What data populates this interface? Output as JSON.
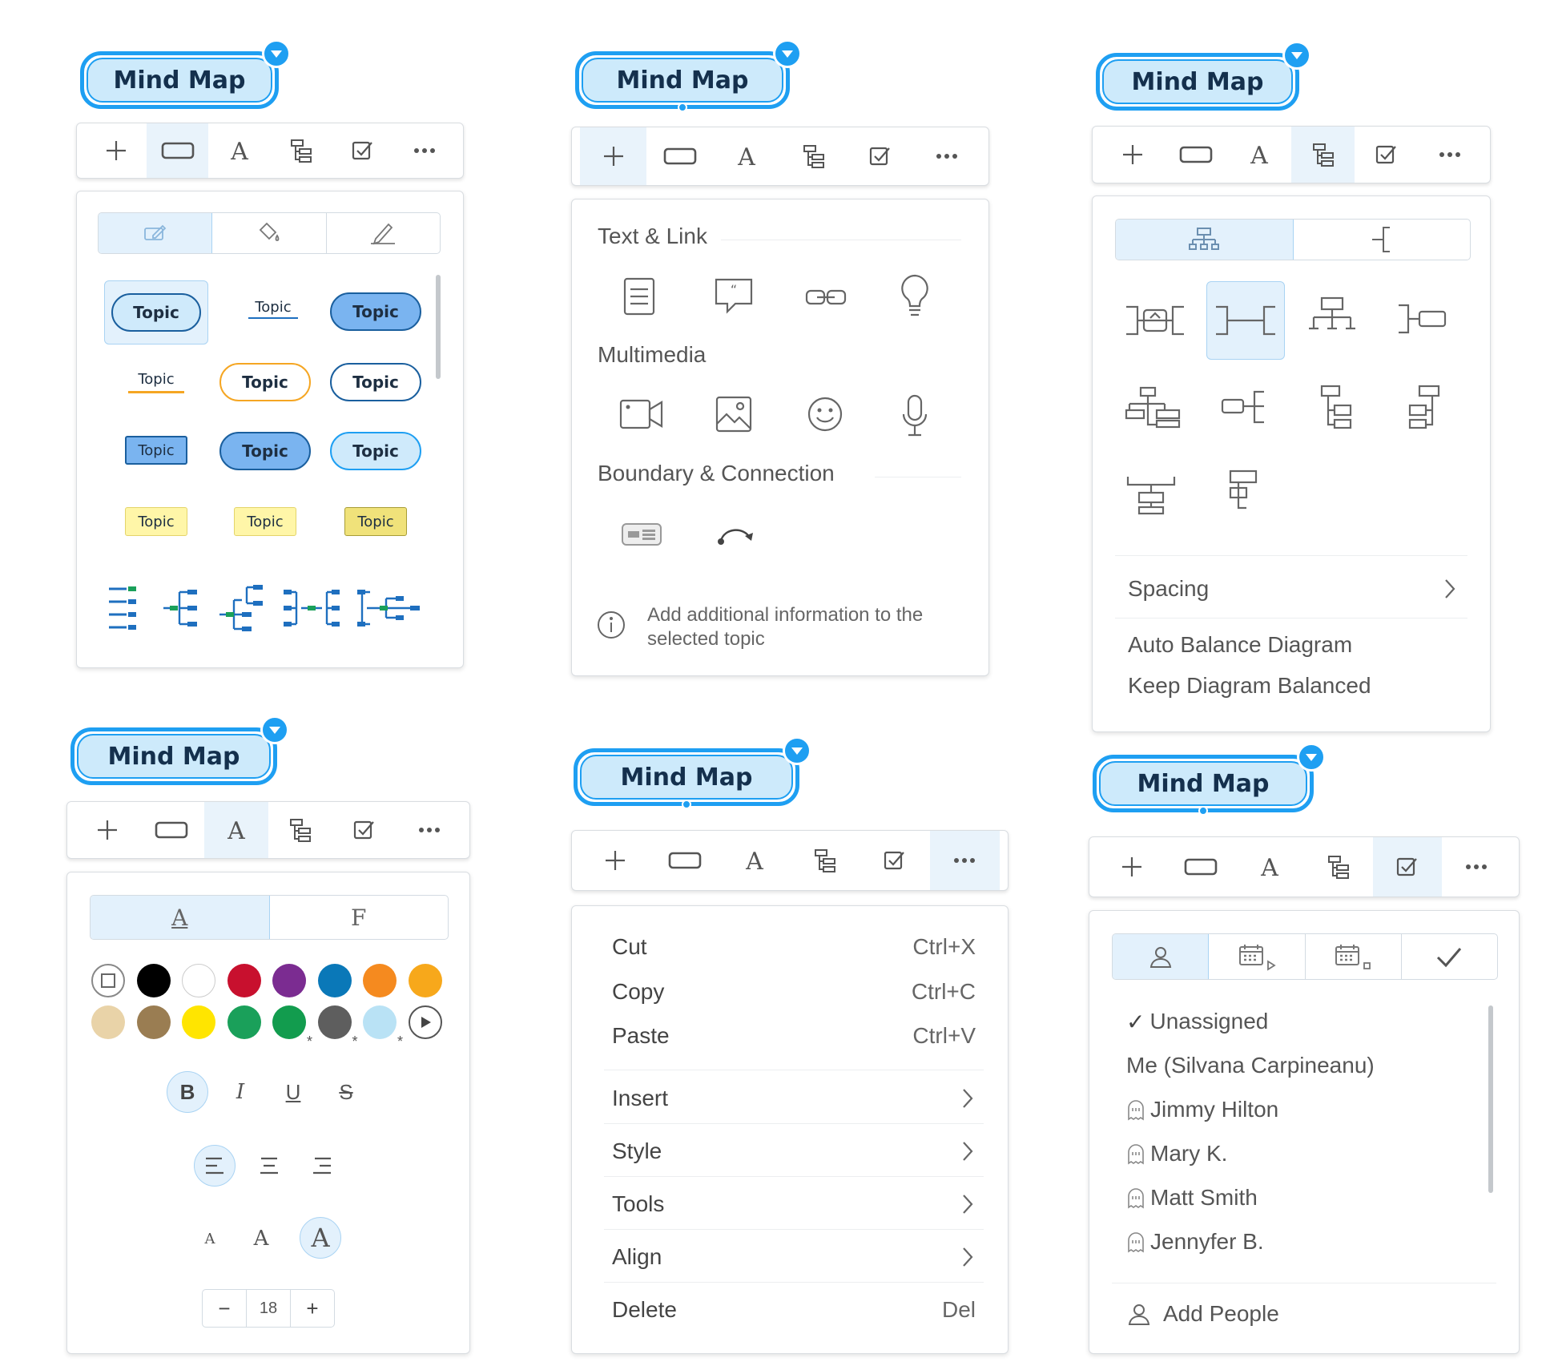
{
  "node_label": "Mind Map",
  "style_panel": {
    "topics": [
      "Topic",
      "Topic",
      "Topic",
      "Topic",
      "Topic",
      "Topic",
      "Topic",
      "Topic",
      "Topic",
      "Topic",
      "Topic",
      "Topic"
    ]
  },
  "insert_panel": {
    "sections": [
      {
        "title": "Text & Link",
        "icons": [
          "note-icon",
          "comment-icon",
          "link-icon",
          "idea-bulb-icon"
        ]
      },
      {
        "title": "Multimedia",
        "icons": [
          "video-icon",
          "image-icon",
          "emoji-icon",
          "microphone-icon"
        ]
      },
      {
        "title": "Boundary & Connection",
        "icons": [
          "boundary-icon",
          "connection-icon"
        ]
      }
    ],
    "info_text": "Add additional information to the selected topic"
  },
  "layout_panel": {
    "spacing_label": "Spacing",
    "options": [
      "Auto Balance Diagram",
      "Keep Diagram Balanced"
    ]
  },
  "text_panel": {
    "tabs": [
      "A",
      "F"
    ],
    "font_size": "18",
    "colors": [
      "#000000",
      "#ffffff",
      "#c8102e",
      "#7b2c91",
      "#0a78b8",
      "#f58a1f",
      "#f7a81b",
      "#e9d3a8",
      "#9a7d52",
      "#ffe500",
      "#1aa05a",
      "#129c4e",
      "#5e5e5e",
      "#b9e2f5"
    ],
    "style_buttons": [
      "B",
      "I",
      "U",
      "S"
    ],
    "size_letters": [
      "A",
      "A",
      "A"
    ]
  },
  "more_menu": {
    "items": [
      {
        "label": "Cut",
        "shortcut": "Ctrl+X"
      },
      {
        "label": "Copy",
        "shortcut": "Ctrl+C"
      },
      {
        "label": "Paste",
        "shortcut": "Ctrl+V"
      },
      {
        "label": "Insert",
        "shortcut": ""
      },
      {
        "label": "Style",
        "shortcut": ""
      },
      {
        "label": "Tools",
        "shortcut": ""
      },
      {
        "label": "Align",
        "shortcut": ""
      },
      {
        "label": "Delete",
        "shortcut": "Del"
      }
    ]
  },
  "assign_panel": {
    "people": [
      "Unassigned",
      "Me (Silvana Carpineanu)",
      "Jimmy Hilton",
      "Mary K.",
      "Matt Smith",
      "Jennyfer B."
    ],
    "checkmark": "✓",
    "add_people": "Add People"
  }
}
